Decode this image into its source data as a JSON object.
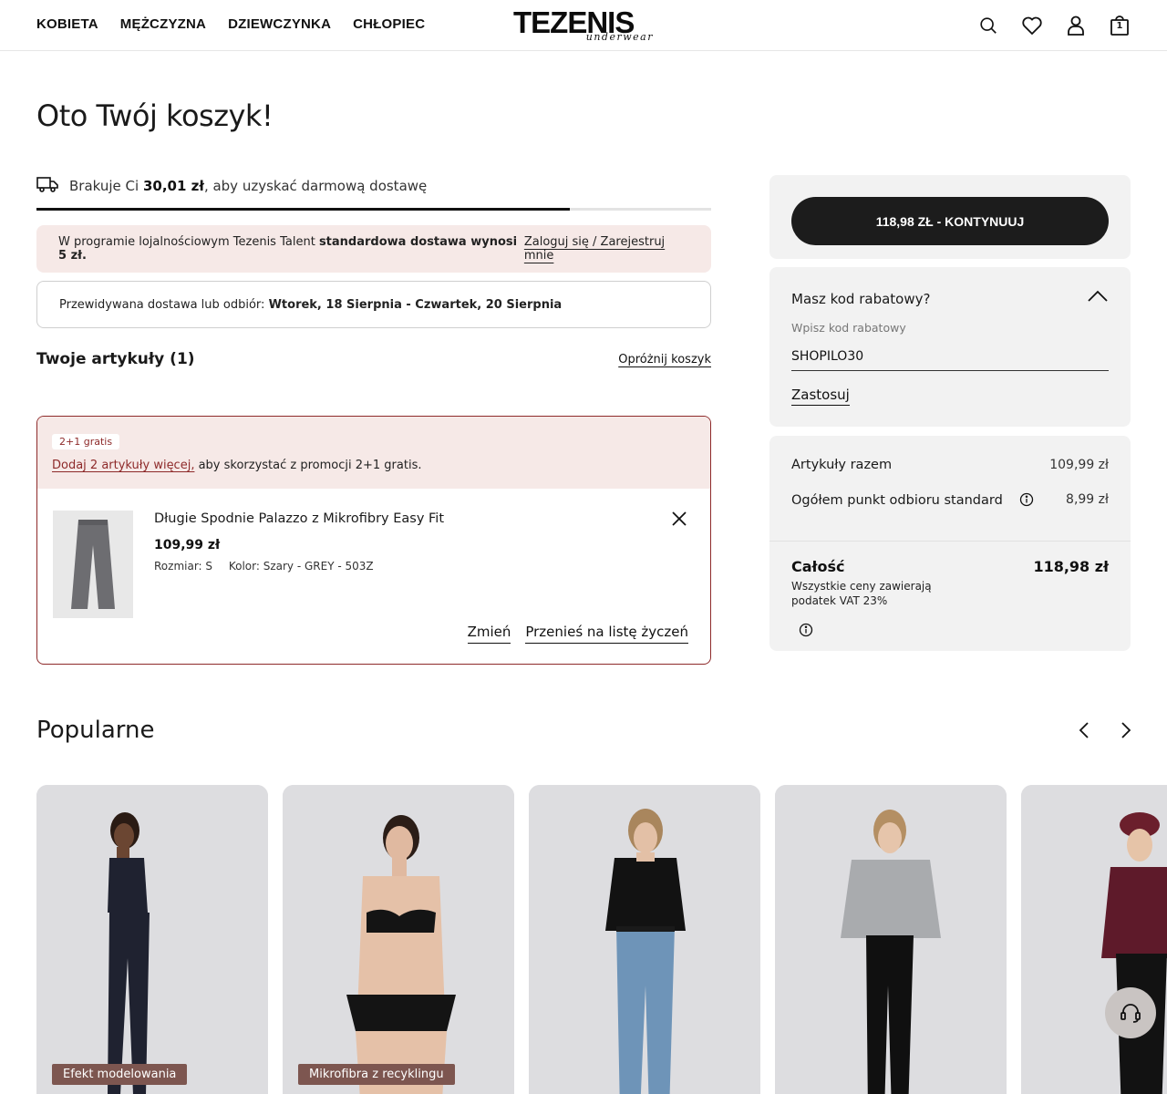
{
  "header": {
    "nav": [
      "KOBIETA",
      "MĘŻCZYZNA",
      "DZIEWCZYNKA",
      "CHŁOPIEC"
    ],
    "logo_main": "TEZENIS",
    "logo_sub": "underwear",
    "cart_count": "1",
    "icons": [
      "search-icon",
      "heart-icon",
      "user-icon",
      "bag-icon"
    ]
  },
  "page": {
    "title": "Oto Twój koszyk!"
  },
  "shipping": {
    "prefix": "Brakuje Ci",
    "amount": "30,01 zł",
    "suffix": ", aby uzyskać darmową dostawę",
    "progress": 0.79
  },
  "loyalty": {
    "text_prefix": "W programie lojalnościowym Tezenis Talent",
    "text_bold": "standardowa dostawa wynosi 5 zł.",
    "link": "Zaloguj się / Zarejestruj mnie"
  },
  "delivery": {
    "label": "Przewidywana dostawa lub odbiór:",
    "dates": "Wtorek, 18 Sierpnia - Czwartek, 20 Sierpnia"
  },
  "items": {
    "title": "Twoje artykuły (1)",
    "empty_link": "Opróżnij koszyk"
  },
  "promo": {
    "badge": "2+1 gratis",
    "link": "Dodaj 2 artykuły więcej,",
    "text": " aby skorzystać z promocji 2+1 gratis."
  },
  "product": {
    "name": "Długie Spodnie Palazzo z Mikrofibry Easy Fit",
    "price": "109,99 zł",
    "size": "Rozmiar: S",
    "color": "Kolor: Szary - GREY - 503Z",
    "change": "Zmień",
    "wishlist": "Przenieś na listę życzeń"
  },
  "checkout": {
    "button": "118,98 ZŁ - KONTYNUUJ"
  },
  "discount": {
    "title": "Masz kod rabatowy?",
    "label": "Wpisz kod rabatowy",
    "value": "SHOPILO30",
    "apply": "Zastosuj"
  },
  "summary": {
    "items_label": "Artykuły razem",
    "items_value": "109,99 zł",
    "shipping_label": "Ogółem punkt odbioru standard",
    "shipping_value": "8,99 zł",
    "total_label": "Całość",
    "total_value": "118,98 zł",
    "vat_note": "Wszystkie ceny zawierają podatek VAT 23%"
  },
  "popular": {
    "title": "Popularne",
    "cards": [
      {
        "badge": "Efekt modelowania"
      },
      {
        "badge": "Mikrofibra z recyklingu"
      },
      {
        "badge": ""
      },
      {
        "badge": ""
      },
      {
        "badge": ""
      }
    ]
  },
  "colors": {
    "accent_red": "#8e2a2a",
    "pink_bg": "#f6e9e7",
    "badge_brown": "#7d5650",
    "button_dark": "#1c1c1c",
    "panel_grey": "#f2f2f2"
  }
}
